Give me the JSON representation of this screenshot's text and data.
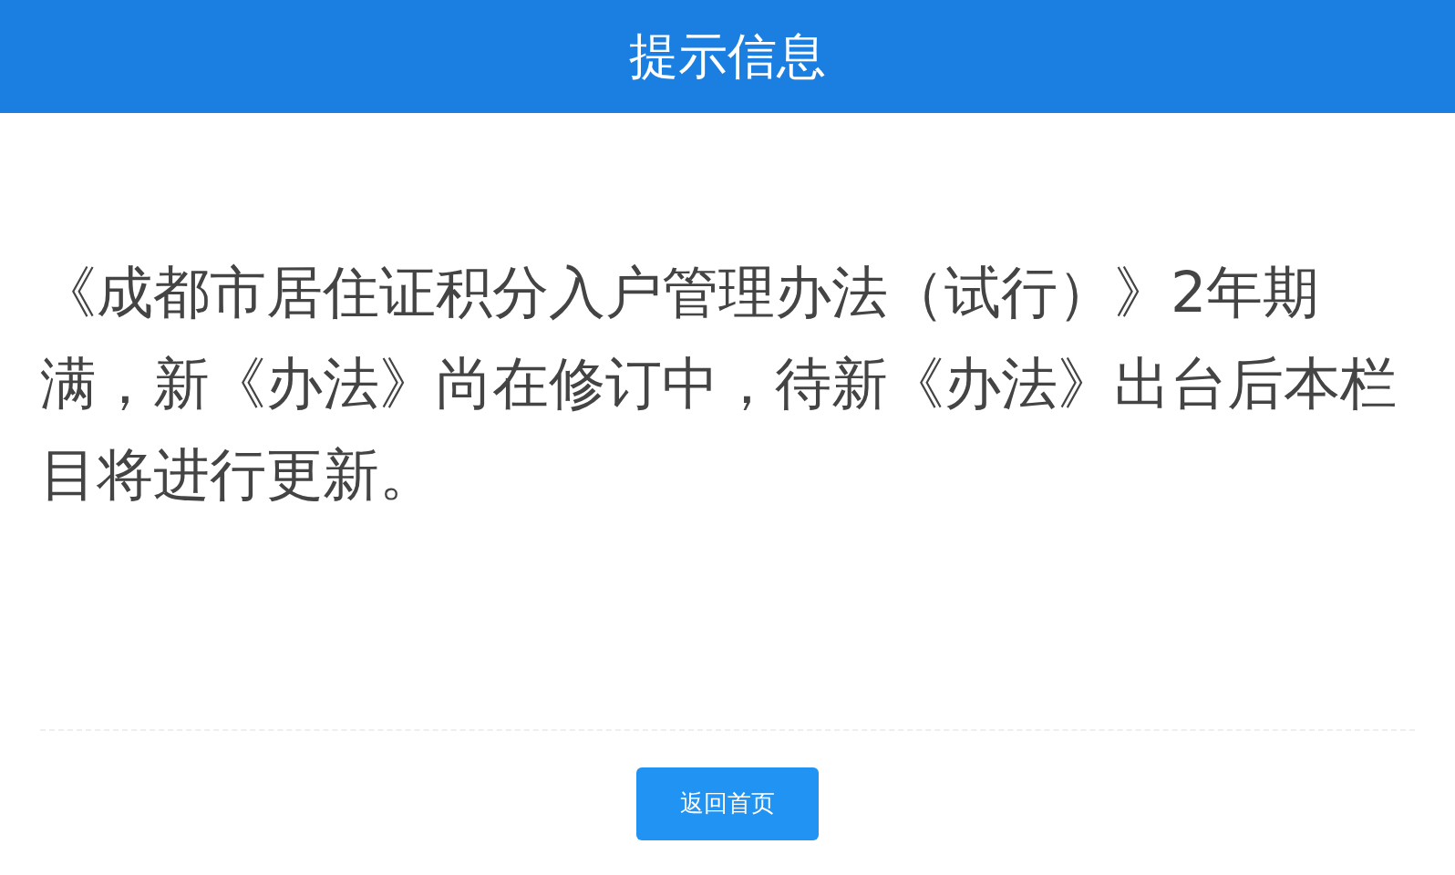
{
  "header": {
    "title": "提示信息"
  },
  "message": "《成都市居住证积分入户管理办法（试行）》2年期满，新《办法》尚在修订中，待新《办法》出台后本栏目将进行更新。",
  "buttons": [
    {
      "label": "返回首页"
    }
  ]
}
